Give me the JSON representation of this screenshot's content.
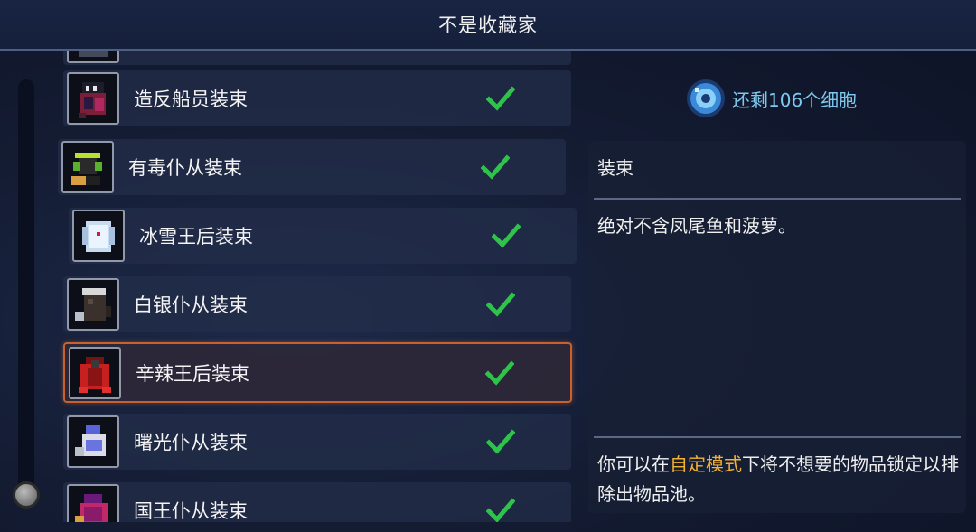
{
  "header": {
    "title": "不是收藏家"
  },
  "outfits": [
    {
      "label": "",
      "icon": "outfit-partial-icon",
      "checked": false
    },
    {
      "label": "造反船员装束",
      "icon": "mutineer-outfit-icon",
      "checked": true
    },
    {
      "label": "有毒仆从装束",
      "icon": "toxic-servant-outfit-icon",
      "checked": true
    },
    {
      "label": "冰雪王后装束",
      "icon": "ice-queen-outfit-icon",
      "checked": true
    },
    {
      "label": "白银仆从装束",
      "icon": "silver-servant-outfit-icon",
      "checked": true
    },
    {
      "label": "辛辣王后装束",
      "icon": "spicy-queen-outfit-icon",
      "checked": true,
      "selected": true
    },
    {
      "label": "曙光仆从装束",
      "icon": "dawn-servant-outfit-icon",
      "checked": true
    },
    {
      "label": "国王仆从装束",
      "icon": "king-servant-outfit-icon",
      "checked": true
    }
  ],
  "cells": {
    "text": "还剩106个细胞",
    "icon": "cell-icon",
    "color": "#7fc9ef"
  },
  "detail": {
    "title": "装束",
    "description": "绝对不含凤尾鱼和菠萝。",
    "hint_pre": "你可以在",
    "hint_highlight": "自定模式",
    "hint_post": "下将不想要的物品锁定以排除出物品池。",
    "highlight_color": "#f2b233"
  },
  "colors": {
    "selection_border": "#c8612e",
    "check_green": "#2ec44a"
  }
}
